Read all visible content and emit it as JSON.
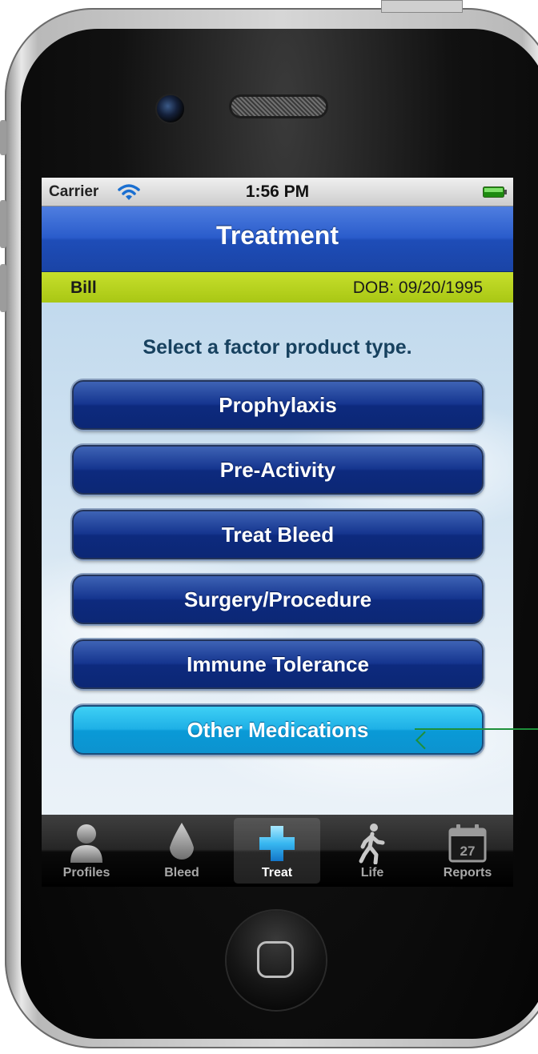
{
  "status_bar": {
    "carrier": "Carrier",
    "time": "1:56 PM",
    "wifi_icon": "wifi-icon",
    "battery_icon": "battery-icon"
  },
  "nav": {
    "title": "Treatment"
  },
  "profile": {
    "name": "Bill",
    "dob": "DOB: 09/20/1995"
  },
  "prompt": "Select a factor product type.",
  "options": [
    {
      "label": "Prophylaxis",
      "selected": false
    },
    {
      "label": "Pre-Activity",
      "selected": false
    },
    {
      "label": "Treat Bleed",
      "selected": false
    },
    {
      "label": "Surgery/Procedure",
      "selected": false
    },
    {
      "label": "Immune Tolerance",
      "selected": false
    },
    {
      "label": "Other Medications",
      "selected": true
    }
  ],
  "tabs": [
    {
      "label": "Profiles",
      "icon": "person-icon",
      "active": false
    },
    {
      "label": "Bleed",
      "icon": "drop-icon",
      "active": false
    },
    {
      "label": "Treat",
      "icon": "cross-icon",
      "active": true
    },
    {
      "label": "Life",
      "icon": "walking-person-icon",
      "active": false
    },
    {
      "label": "Reports",
      "icon": "calendar-icon",
      "active": false,
      "calendar_day": "27"
    }
  ],
  "colors": {
    "nav_blue": "#2a5ccb",
    "profile_bar": "#b4d21c",
    "button_dark": "#15358f",
    "button_selected": "#1eb0e6",
    "callout_arrow": "#1e8f3a"
  }
}
